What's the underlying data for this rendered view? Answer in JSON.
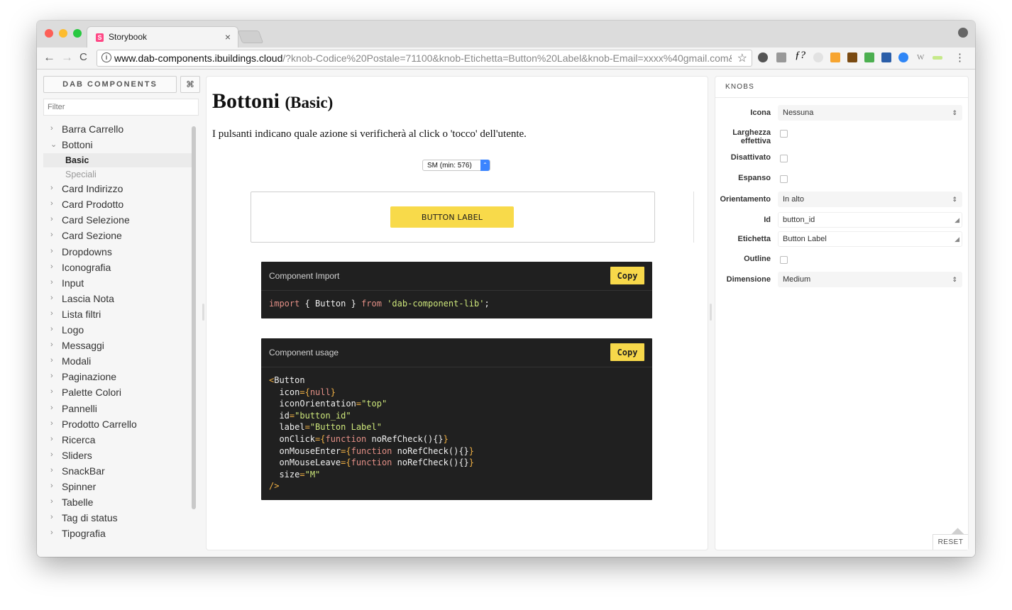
{
  "browser": {
    "tab_title": "Storybook",
    "tab_close": "×",
    "url_host": "www.dab-components.ibuildings.cloud",
    "url_rest": "/?knob-Codice%20Postale=71100&knob-Etichetta=Button%20Label&knob-Email=xxxx%40gmail.com&kn...",
    "back": "←",
    "forward": "→",
    "reload": "C",
    "info": "i",
    "star": "☆",
    "menu": "⋮"
  },
  "sidebar": {
    "brand": "DAB COMPONENTS",
    "shortcut": "⌘",
    "filter_placeholder": "Filter",
    "items": [
      {
        "label": "Barra Carrello",
        "chev": "›"
      },
      {
        "label": "Bottoni",
        "chev": "⌄"
      },
      {
        "label": "Card Indirizzo",
        "chev": "›"
      },
      {
        "label": "Card Prodotto",
        "chev": "›"
      },
      {
        "label": "Card Selezione",
        "chev": "›"
      },
      {
        "label": "Card Sezione",
        "chev": "›"
      },
      {
        "label": "Dropdowns",
        "chev": "›"
      },
      {
        "label": "Iconografia",
        "chev": "›"
      },
      {
        "label": "Input",
        "chev": "›"
      },
      {
        "label": "Lascia Nota",
        "chev": "›"
      },
      {
        "label": "Lista filtri",
        "chev": "›"
      },
      {
        "label": "Logo",
        "chev": "›"
      },
      {
        "label": "Messaggi",
        "chev": "›"
      },
      {
        "label": "Modali",
        "chev": "›"
      },
      {
        "label": "Paginazione",
        "chev": "›"
      },
      {
        "label": "Palette Colori",
        "chev": "›"
      },
      {
        "label": "Pannelli",
        "chev": "›"
      },
      {
        "label": "Prodotto Carrello",
        "chev": "›"
      },
      {
        "label": "Ricerca",
        "chev": "›"
      },
      {
        "label": "Sliders",
        "chev": "›"
      },
      {
        "label": "SnackBar",
        "chev": "›"
      },
      {
        "label": "Spinner",
        "chev": "›"
      },
      {
        "label": "Tabelle",
        "chev": "›"
      },
      {
        "label": "Tag di status",
        "chev": "›"
      },
      {
        "label": "Tipografia",
        "chev": "›"
      }
    ],
    "subitems": [
      {
        "label": "Basic",
        "active": true
      },
      {
        "label": "Speciali",
        "active": false
      }
    ]
  },
  "preview": {
    "title": "Bottoni",
    "subtitle": "(Basic)",
    "description": "I pulsanti indicano quale azione si verificherà al click o 'tocco' dell'utente.",
    "breakpoint": "SM (min: 576)",
    "breakpoint_arrow": "⌃",
    "button_label": "BUTTON LABEL",
    "import_box": {
      "title": "Component Import",
      "copy": "Copy",
      "kw1": "import",
      "mid": " { Button } ",
      "kw2": "from",
      "str": "'dab-component-lib'",
      "end": ";"
    },
    "usage_box": {
      "title": "Component usage",
      "copy": "Copy",
      "tag_open": "<",
      "tag_name": "Button",
      "icon_attr": "  icon",
      "icon_val": "null",
      "orient_attr": "  iconOrientation",
      "orient_val": "\"top\"",
      "id_attr": "  id",
      "id_val": "\"button_id\"",
      "label_attr": "  label",
      "label_val": "\"Button Label\"",
      "click_attr": "  onClick",
      "enter_attr": "  onMouseEnter",
      "leave_attr": "  onMouseLeave",
      "fn_kw": "function",
      "fn_name": " noRefCheck(){}",
      "size_attr": "  size",
      "size_val": "\"M\"",
      "tag_close": "/>"
    }
  },
  "knobs": {
    "title": "KNOBS",
    "icona_label": "Icona",
    "icona_value": "Nessuna",
    "larghezza_label": "Larghezza effettiva",
    "disattivato_label": "Disattivato",
    "espanso_label": "Espanso",
    "orient_label": "Orientamento",
    "orient_value": "In alto",
    "id_label": "Id",
    "id_value": "button_id",
    "etichetta_label": "Etichetta",
    "etichetta_value": "Button Label",
    "outline_label": "Outline",
    "dimensione_label": "Dimensione",
    "dimensione_value": "Medium",
    "select_arrow": "⇕",
    "reset": "RESET"
  },
  "colors": {
    "accent_yellow": "#f8da4a",
    "code_bg": "#202020",
    "storybook_pink": "#ff4785"
  }
}
